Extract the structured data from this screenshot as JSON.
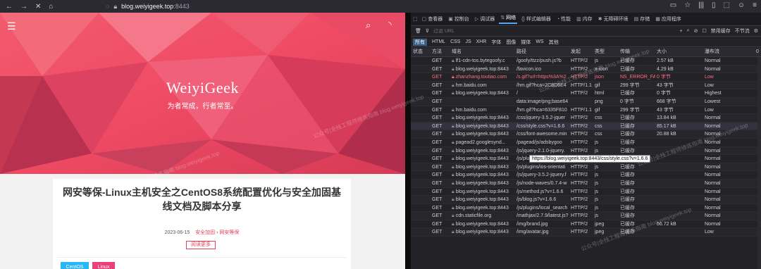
{
  "browser": {
    "url_host": "blog.weiyigeek.top",
    "url_port": ":8443"
  },
  "blog": {
    "site_name": "WeiyiGeek",
    "tagline": "为者常成，行者常至。",
    "post": {
      "title": "网安等保-Linux主机安全之CentOS8系统配置优化与安全加固基线文档及脚本分享",
      "date": "2023-06-15",
      "category_1": "安全加固",
      "category_sep": "›",
      "category_2": "网安等保",
      "read_more": "阅读更多",
      "tags": [
        "CentOS",
        "Linux"
      ]
    }
  },
  "devtools": {
    "tabs": [
      "查看器",
      "控制台",
      "调试器",
      "网络",
      "样式编辑器",
      "性能",
      "内存",
      "无障碍环境",
      "存储",
      "应用程序"
    ],
    "filter_placeholder": "过滤 URL",
    "disable_cache": "禁用缓存",
    "throttle": "不节流",
    "types": [
      "所有",
      "HTML",
      "CSS",
      "JS",
      "XHR",
      "字体",
      "图像",
      "媒体",
      "WS",
      "其他"
    ],
    "columns": [
      "状态",
      "方法",
      "域名",
      "路径",
      "发起",
      "类型",
      "传输",
      "大小",
      "瀑布流",
      "0"
    ],
    "rows": [
      {
        "status": "200",
        "method": "GET",
        "domain": "lf1-cdn-tos.bytegoofy.c",
        "file": "/goofy/ttzz/push.js?b",
        "init": "HTTP/2",
        "type": "js",
        "transferred": "已缓存",
        "size": "2.57 kB",
        "waterfall": "Normal"
      },
      {
        "status": "200",
        "method": "GET",
        "domain": "blog.weiyigeek.top:8443",
        "file": "/favicon.ico",
        "init": "HTTP/2",
        "type": "x-icon",
        "transferred": "已缓存",
        "size": "4.29 kB",
        "waterfall": "Normal"
      },
      {
        "status": "blocked",
        "method": "GET",
        "domain": "zhanzhang.toutiao.com",
        "file": "/s.gif?url=https%3A%2",
        "init": "HTTP/2",
        "type": "json",
        "transferred": "NS_ERROR_FA...",
        "size": "0 字节",
        "waterfall": "Low"
      },
      {
        "status": "200",
        "method": "GET",
        "domain": "hm.baidu.com",
        "file": "/hm.gif?hca=2C8D6E4",
        "init": "HTTP/1.1",
        "type": "gif",
        "transferred": "299 字节",
        "size": "43 字节",
        "waterfall": "Low"
      },
      {
        "status": "200",
        "method": "GET",
        "domain": "blog.weiyigeek.top:8443",
        "file": "/",
        "init": "HTTP/2",
        "type": "html",
        "transferred": "已缓存",
        "size": "0 字节",
        "waterfall": "Highest"
      },
      {
        "status": "200",
        "method": "GET",
        "domain": "",
        "file": "data:image/png;base64",
        "init": "",
        "type": "png",
        "transferred": "0 字节",
        "size": "668 字节",
        "waterfall": "Lowest"
      },
      {
        "status": "200",
        "method": "GET",
        "domain": "hm.baidu.com",
        "file": "/hm.gif?hca=6335F810",
        "init": "HTTP/1.1",
        "type": "gif",
        "transferred": "299 字节",
        "size": "43 字节",
        "waterfall": "Low"
      },
      {
        "status": "200",
        "method": "GET",
        "domain": "blog.weiyigeek.top:8443",
        "file": "/css/jquery-3.5.2-jquer",
        "init": "HTTP/2",
        "type": "css",
        "transferred": "已缓存",
        "size": "13.84 kB",
        "waterfall": "Normal"
      },
      {
        "status": "200",
        "method": "GET",
        "domain": "blog.weiyigeek.top:8443",
        "file": "/css/style.css?v=1.6.6",
        "init": "HTTP/2",
        "type": "css",
        "transferred": "已缓存",
        "size": "85.17 kB",
        "waterfall": "Normal"
      },
      {
        "status": "200",
        "method": "GET",
        "domain": "blog.weiyigeek.top:8443",
        "file": "/css/font-awesome.min",
        "init": "HTTP/2",
        "type": "css",
        "transferred": "已缓存",
        "size": "20.88 kB",
        "waterfall": "Normal"
      },
      {
        "status": "200",
        "method": "GET",
        "domain": "pagead2.googlesynd...",
        "file": "/pagead/js/adsbygoo",
        "init": "HTTP/2",
        "type": "js",
        "transferred": "已缓存",
        "size": "",
        "waterfall": "Normal"
      },
      {
        "status": "200",
        "method": "GET",
        "domain": "blog.weiyigeek.top:8443",
        "file": "/js/jquery-2.1.0-jquery.",
        "init": "HTTP/2",
        "type": "js",
        "transferred": "已缓存",
        "size": "",
        "waterfall": "Normal"
      },
      {
        "status": "200",
        "method": "GET",
        "domain": "blog.weiyigeek.top:8443",
        "file": "/js/plugins/fastclick.js?v",
        "init": "HTTP/2",
        "type": "js",
        "transferred": "已缓存",
        "size": "",
        "waterfall": "Normal"
      },
      {
        "status": "200",
        "method": "GET",
        "domain": "blog.weiyigeek.top:8443",
        "file": "/js/plugins/ios-orientati",
        "init": "HTTP/2",
        "type": "js",
        "transferred": "已缓存",
        "size": "",
        "waterfall": "Normal"
      },
      {
        "status": "200",
        "method": "GET",
        "domain": "blog.weiyigeek.top:8443",
        "file": "/js/jquery-3.5.2-jquery.f",
        "init": "HTTP/2",
        "type": "js",
        "transferred": "已缓存",
        "size": "",
        "waterfall": "Normal"
      },
      {
        "status": "200",
        "method": "GET",
        "domain": "blog.weiyigeek.top:8443",
        "file": "/js/node-waves/0.7.4-w",
        "init": "HTTP/2",
        "type": "js",
        "transferred": "已缓存",
        "size": "",
        "waterfall": "Normal"
      },
      {
        "status": "200",
        "method": "GET",
        "domain": "blog.weiyigeek.top:8443",
        "file": "/js/method.js?v=1.6.6",
        "init": "HTTP/2",
        "type": "js",
        "transferred": "已缓存",
        "size": "",
        "waterfall": "Normal"
      },
      {
        "status": "200",
        "method": "GET",
        "domain": "blog.weiyigeek.top:8443",
        "file": "/js/blog.js?v=1.6.6",
        "init": "HTTP/2",
        "type": "js",
        "transferred": "已缓存",
        "size": "",
        "waterfall": "Normal"
      },
      {
        "status": "200",
        "method": "GET",
        "domain": "blog.weiyigeek.top:8443",
        "file": "/js/plugins/local_search",
        "init": "HTTP/2",
        "type": "js",
        "transferred": "已缓存",
        "size": "",
        "waterfall": "Normal"
      },
      {
        "status": "200",
        "method": "GET",
        "domain": "cdn.staticfile.org",
        "file": "/mathjax/2.7.9/latest.js?",
        "init": "HTTP/2",
        "type": "js",
        "transferred": "已缓存",
        "size": "",
        "waterfall": "Normal"
      },
      {
        "status": "200",
        "method": "GET",
        "domain": "blog.weiyigeek.top:8443",
        "file": "/img/brand.jpg",
        "init": "HTTP/2",
        "type": "jpeg",
        "transferred": "已缓存",
        "size": "56.72 kB",
        "waterfall": "Normal"
      },
      {
        "status": "200",
        "method": "GET",
        "domain": "blog.weiyigeek.top:8443",
        "file": "/img/avatar.jpg",
        "init": "HTTP/2",
        "type": "jpeg",
        "transferred": "已缓存",
        "size": "",
        "waterfall": "Low"
      }
    ],
    "tooltip": "https://blog.weiyigeek.top:8443/css/style.css?v=1.6.6"
  },
  "watermark": "公众号|全栈工程师修炼指南 blog.weiyigeek.top",
  "colors": {
    "accent": "#e5425a",
    "devtools_bg": "#232327",
    "tag_centos": "#29b6f6",
    "tag_linux": "#ec407a"
  }
}
